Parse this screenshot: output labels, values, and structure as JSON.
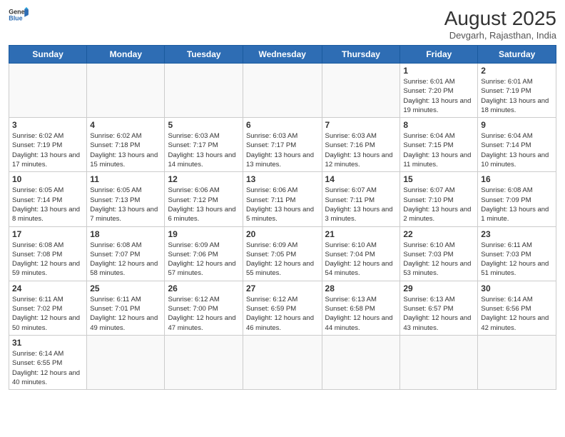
{
  "header": {
    "logo_general": "General",
    "logo_blue": "Blue",
    "month_title": "August 2025",
    "subtitle": "Devgarh, Rajasthan, India"
  },
  "weekdays": [
    "Sunday",
    "Monday",
    "Tuesday",
    "Wednesday",
    "Thursday",
    "Friday",
    "Saturday"
  ],
  "weeks": [
    [
      {
        "day": "",
        "info": ""
      },
      {
        "day": "",
        "info": ""
      },
      {
        "day": "",
        "info": ""
      },
      {
        "day": "",
        "info": ""
      },
      {
        "day": "",
        "info": ""
      },
      {
        "day": "1",
        "info": "Sunrise: 6:01 AM\nSunset: 7:20 PM\nDaylight: 13 hours and 19 minutes."
      },
      {
        "day": "2",
        "info": "Sunrise: 6:01 AM\nSunset: 7:19 PM\nDaylight: 13 hours and 18 minutes."
      }
    ],
    [
      {
        "day": "3",
        "info": "Sunrise: 6:02 AM\nSunset: 7:19 PM\nDaylight: 13 hours and 17 minutes."
      },
      {
        "day": "4",
        "info": "Sunrise: 6:02 AM\nSunset: 7:18 PM\nDaylight: 13 hours and 15 minutes."
      },
      {
        "day": "5",
        "info": "Sunrise: 6:03 AM\nSunset: 7:17 PM\nDaylight: 13 hours and 14 minutes."
      },
      {
        "day": "6",
        "info": "Sunrise: 6:03 AM\nSunset: 7:17 PM\nDaylight: 13 hours and 13 minutes."
      },
      {
        "day": "7",
        "info": "Sunrise: 6:03 AM\nSunset: 7:16 PM\nDaylight: 13 hours and 12 minutes."
      },
      {
        "day": "8",
        "info": "Sunrise: 6:04 AM\nSunset: 7:15 PM\nDaylight: 13 hours and 11 minutes."
      },
      {
        "day": "9",
        "info": "Sunrise: 6:04 AM\nSunset: 7:14 PM\nDaylight: 13 hours and 10 minutes."
      }
    ],
    [
      {
        "day": "10",
        "info": "Sunrise: 6:05 AM\nSunset: 7:14 PM\nDaylight: 13 hours and 8 minutes."
      },
      {
        "day": "11",
        "info": "Sunrise: 6:05 AM\nSunset: 7:13 PM\nDaylight: 13 hours and 7 minutes."
      },
      {
        "day": "12",
        "info": "Sunrise: 6:06 AM\nSunset: 7:12 PM\nDaylight: 13 hours and 6 minutes."
      },
      {
        "day": "13",
        "info": "Sunrise: 6:06 AM\nSunset: 7:11 PM\nDaylight: 13 hours and 5 minutes."
      },
      {
        "day": "14",
        "info": "Sunrise: 6:07 AM\nSunset: 7:11 PM\nDaylight: 13 hours and 3 minutes."
      },
      {
        "day": "15",
        "info": "Sunrise: 6:07 AM\nSunset: 7:10 PM\nDaylight: 13 hours and 2 minutes."
      },
      {
        "day": "16",
        "info": "Sunrise: 6:08 AM\nSunset: 7:09 PM\nDaylight: 13 hours and 1 minute."
      }
    ],
    [
      {
        "day": "17",
        "info": "Sunrise: 6:08 AM\nSunset: 7:08 PM\nDaylight: 12 hours and 59 minutes."
      },
      {
        "day": "18",
        "info": "Sunrise: 6:08 AM\nSunset: 7:07 PM\nDaylight: 12 hours and 58 minutes."
      },
      {
        "day": "19",
        "info": "Sunrise: 6:09 AM\nSunset: 7:06 PM\nDaylight: 12 hours and 57 minutes."
      },
      {
        "day": "20",
        "info": "Sunrise: 6:09 AM\nSunset: 7:05 PM\nDaylight: 12 hours and 55 minutes."
      },
      {
        "day": "21",
        "info": "Sunrise: 6:10 AM\nSunset: 7:04 PM\nDaylight: 12 hours and 54 minutes."
      },
      {
        "day": "22",
        "info": "Sunrise: 6:10 AM\nSunset: 7:03 PM\nDaylight: 12 hours and 53 minutes."
      },
      {
        "day": "23",
        "info": "Sunrise: 6:11 AM\nSunset: 7:03 PM\nDaylight: 12 hours and 51 minutes."
      }
    ],
    [
      {
        "day": "24",
        "info": "Sunrise: 6:11 AM\nSunset: 7:02 PM\nDaylight: 12 hours and 50 minutes."
      },
      {
        "day": "25",
        "info": "Sunrise: 6:11 AM\nSunset: 7:01 PM\nDaylight: 12 hours and 49 minutes."
      },
      {
        "day": "26",
        "info": "Sunrise: 6:12 AM\nSunset: 7:00 PM\nDaylight: 12 hours and 47 minutes."
      },
      {
        "day": "27",
        "info": "Sunrise: 6:12 AM\nSunset: 6:59 PM\nDaylight: 12 hours and 46 minutes."
      },
      {
        "day": "28",
        "info": "Sunrise: 6:13 AM\nSunset: 6:58 PM\nDaylight: 12 hours and 44 minutes."
      },
      {
        "day": "29",
        "info": "Sunrise: 6:13 AM\nSunset: 6:57 PM\nDaylight: 12 hours and 43 minutes."
      },
      {
        "day": "30",
        "info": "Sunrise: 6:14 AM\nSunset: 6:56 PM\nDaylight: 12 hours and 42 minutes."
      }
    ],
    [
      {
        "day": "31",
        "info": "Sunrise: 6:14 AM\nSunset: 6:55 PM\nDaylight: 12 hours and 40 minutes."
      },
      {
        "day": "",
        "info": ""
      },
      {
        "day": "",
        "info": ""
      },
      {
        "day": "",
        "info": ""
      },
      {
        "day": "",
        "info": ""
      },
      {
        "day": "",
        "info": ""
      },
      {
        "day": "",
        "info": ""
      }
    ]
  ]
}
